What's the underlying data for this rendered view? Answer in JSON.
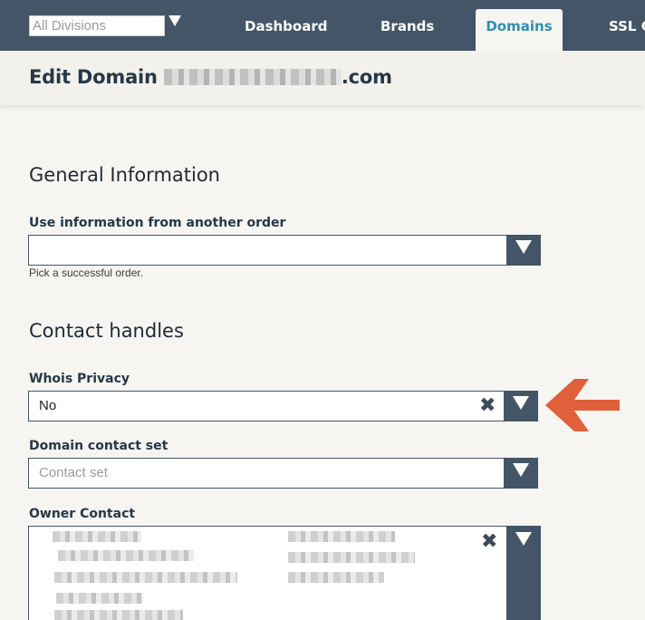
{
  "nav": {
    "division_select": "All Divisions",
    "tabs": [
      "Dashboard",
      "Brands",
      "Domains",
      "SSL C"
    ],
    "active_tab": "Domains"
  },
  "page": {
    "title_prefix": "Edit Domain ",
    "title_suffix": ".com"
  },
  "general": {
    "heading": "General Information",
    "use_info_label": "Use information from another order",
    "use_info_value": "",
    "use_info_help": "Pick a successful order."
  },
  "contacts": {
    "heading": "Contact handles",
    "whois_label": "Whois Privacy",
    "whois_value": "No",
    "contact_set_label": "Domain contact set",
    "contact_set_placeholder": "Contact set",
    "owner_label": "Owner Contact"
  },
  "annotation": {
    "arrow_color": "#e0603c"
  },
  "colors": {
    "nav_bg": "#435566",
    "active_tab_text": "#2d8fb6",
    "page_bg": "#f6f5f2"
  }
}
